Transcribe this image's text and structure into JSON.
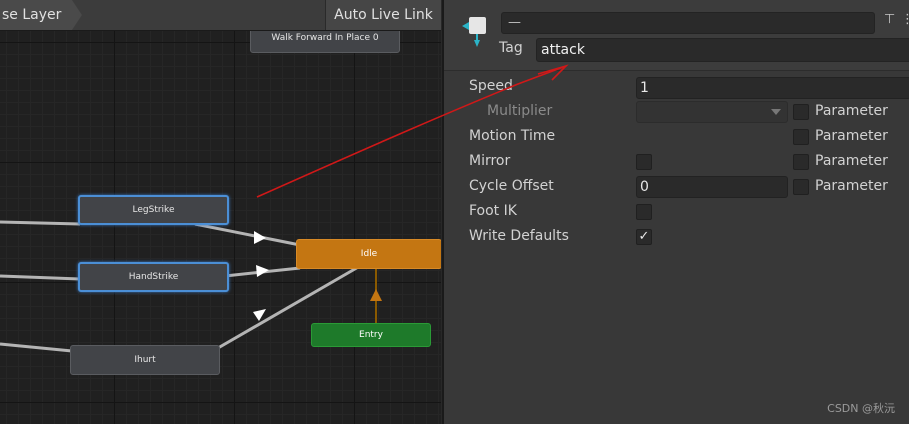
{
  "toolbar": {
    "breadcrumb": "se Layer",
    "live_link": "Auto Live Link"
  },
  "graph": {
    "nodes": {
      "walk": "Walk Forward In Place 0",
      "legstrike": "LegStrike",
      "handstrike": "HandStrike",
      "hurt": "Ihurt",
      "idle": "Idle",
      "entry": "Entry"
    }
  },
  "inspector": {
    "state_name": "—",
    "tag_label": "Tag",
    "tag_value": "attack",
    "rows": {
      "speed": {
        "label": "Speed",
        "value": "1"
      },
      "multiplier": {
        "label": "Multiplier"
      },
      "motion_time": {
        "label": "Motion Time"
      },
      "mirror": {
        "label": "Mirror"
      },
      "cycle_offset": {
        "label": "Cycle Offset",
        "value": "0"
      },
      "foot_ik": {
        "label": "Foot IK"
      },
      "write_defaults": {
        "label": "Write Defaults",
        "checked_glyph": "✓"
      }
    },
    "parameter_label": "Parameter"
  },
  "watermark": "CSDN @秋沅",
  "colors": {
    "idle_node": "#c47612",
    "entry_node": "#1e7a2a",
    "selected_outline": "#4b8fd6",
    "annotation_arrow": "#d01818"
  },
  "icons": {
    "state": "animator-state-icon",
    "header_buttons": [
      "layout-icon",
      "settings-icon"
    ]
  }
}
